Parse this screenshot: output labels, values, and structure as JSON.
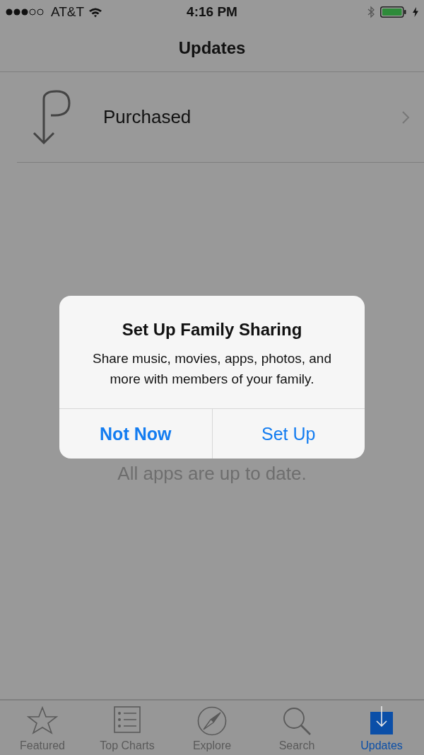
{
  "status_bar": {
    "carrier": "AT&T",
    "time": "4:16 PM"
  },
  "nav": {
    "title": "Updates"
  },
  "purchased_row": {
    "label": "Purchased"
  },
  "empty_message": "All apps are up to date.",
  "alert": {
    "title": "Set Up Family Sharing",
    "message": "Share music, movies, apps, photos, and more with members of your family.",
    "buttons": [
      {
        "label": "Not Now",
        "kind": "preferred"
      },
      {
        "label": "Set Up",
        "kind": "default"
      }
    ]
  },
  "tabs": [
    {
      "label": "Featured",
      "kind": "star",
      "selected": false
    },
    {
      "label": "Top Charts",
      "kind": "list",
      "selected": false
    },
    {
      "label": "Explore",
      "kind": "compass",
      "selected": false
    },
    {
      "label": "Search",
      "kind": "search",
      "selected": false
    },
    {
      "label": "Updates",
      "kind": "updates",
      "selected": true
    }
  ]
}
